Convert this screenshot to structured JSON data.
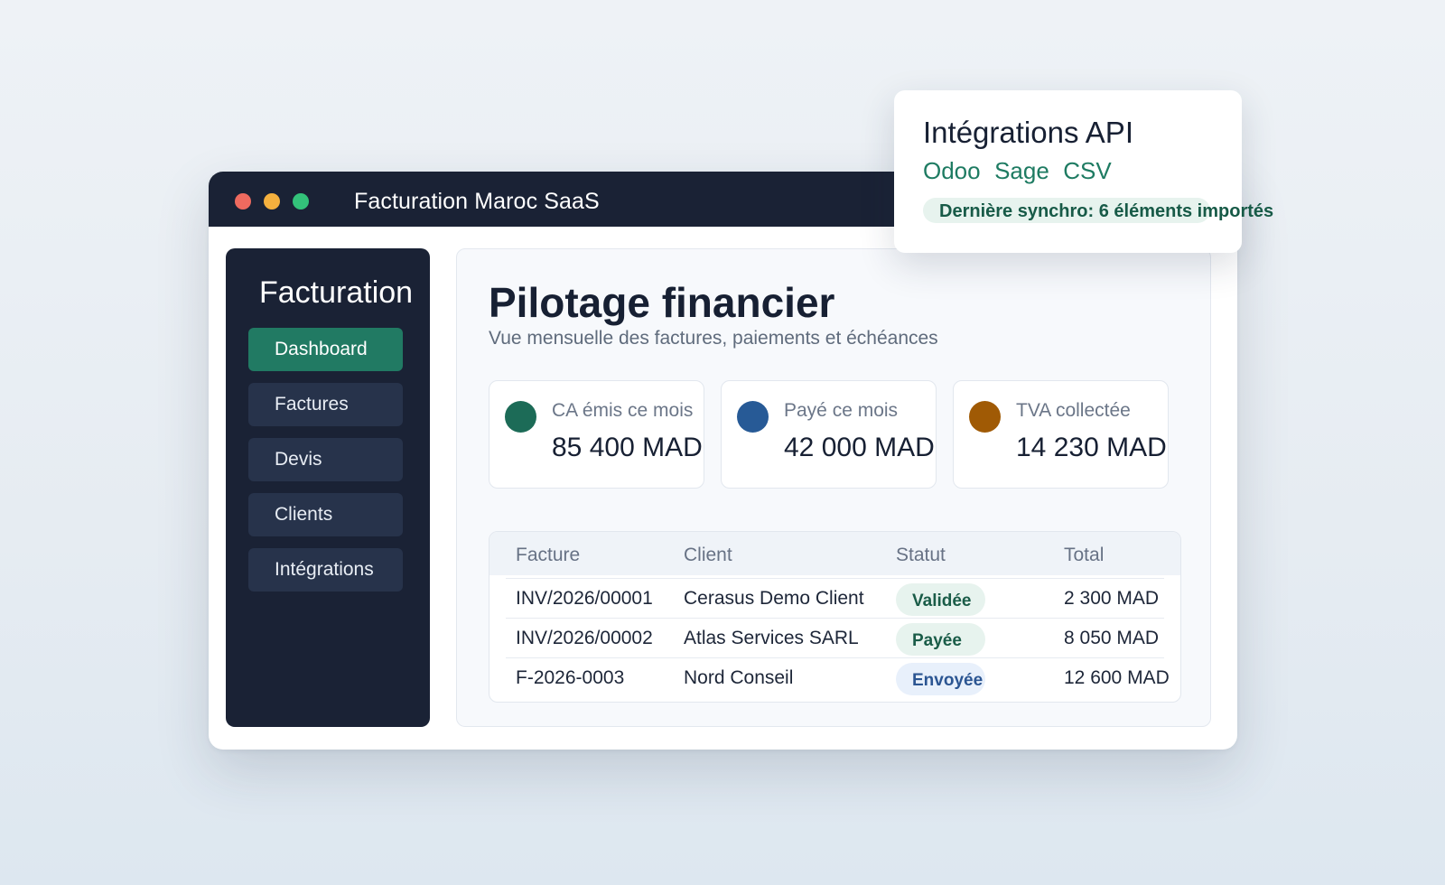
{
  "window": {
    "title": "Facturation Maroc SaaS"
  },
  "sidebar": {
    "brand": "Facturation",
    "items": [
      {
        "label": "Dashboard",
        "active": true
      },
      {
        "label": "Factures",
        "active": false
      },
      {
        "label": "Devis",
        "active": false
      },
      {
        "label": "Clients",
        "active": false
      },
      {
        "label": "Intégrations",
        "active": false
      }
    ]
  },
  "main": {
    "title": "Pilotage financier",
    "subtitle": "Vue mensuelle des factures, paiements et échéances",
    "kpis": [
      {
        "label": "CA émis ce mois",
        "value": "85 400 MAD",
        "color": "#1c6b57"
      },
      {
        "label": "Payé ce mois",
        "value": "42 000 MAD",
        "color": "#275a96"
      },
      {
        "label": "TVA collectée",
        "value": "14 230 MAD",
        "color": "#a05a05"
      }
    ],
    "table": {
      "columns": [
        "Facture",
        "Client",
        "Statut",
        "Total"
      ],
      "rows": [
        {
          "invoice": "INV/2026/00001",
          "client": "Cerasus Demo Client",
          "status": "Validée",
          "total": "2 300 MAD"
        },
        {
          "invoice": "INV/2026/00002",
          "client": "Atlas Services SARL",
          "status": "Payée",
          "total": "8 050 MAD"
        },
        {
          "invoice": "F-2026-0003",
          "client": "Nord Conseil",
          "status": "Envoyée",
          "total": "12 600 MAD"
        }
      ]
    }
  },
  "integrations": {
    "title": "Intégrations API",
    "links": [
      "Odoo",
      "Sage",
      "CSV"
    ],
    "sync_status": "Dernière synchro: 6 éléments importés"
  },
  "colors": {
    "titlebar": "#1a2235",
    "accent": "#217a63",
    "nav_item": "#27334b",
    "status_green": "#1a5c48",
    "status_blue": "#2b5592"
  }
}
